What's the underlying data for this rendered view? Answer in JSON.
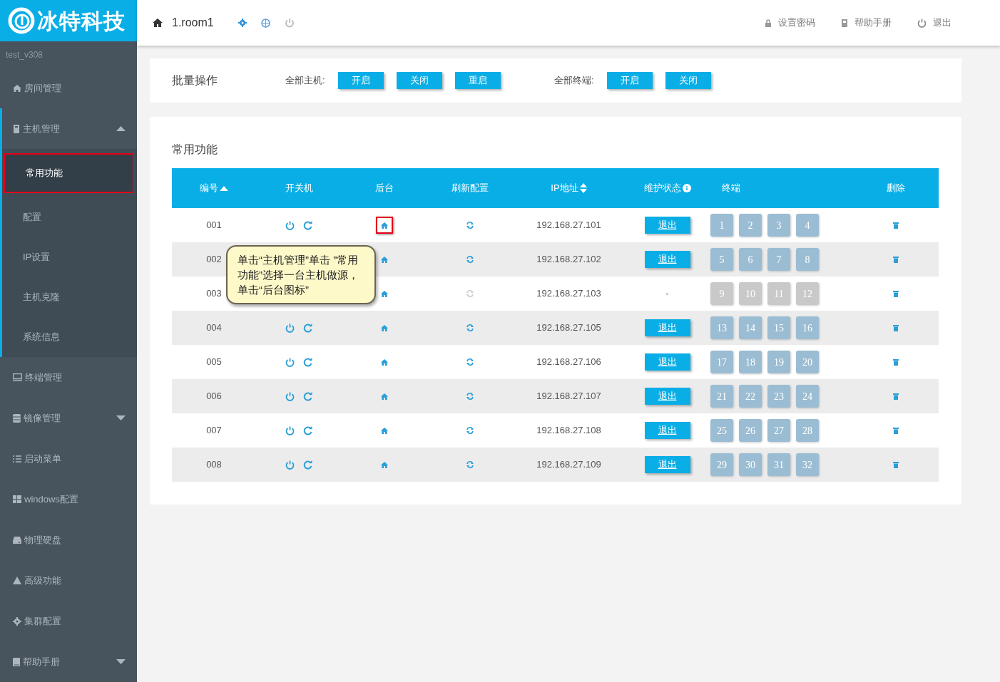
{
  "brand": {
    "name": "冰特科技"
  },
  "header": {
    "room": "1.room1",
    "links": [
      {
        "kind": "lock",
        "label": "设置密码"
      },
      {
        "kind": "book",
        "label": "帮助手册"
      },
      {
        "kind": "power",
        "label": "退出"
      }
    ]
  },
  "sidebar": {
    "version": "test_v308",
    "items": [
      {
        "kind": "home",
        "label": "房间管理"
      },
      {
        "kind": "server",
        "label": "主机管理",
        "expanded": true,
        "children": [
          {
            "label": "常用功能",
            "selected": true,
            "highlighted": true
          },
          {
            "label": "配置",
            "selected": false,
            "highlighted": false
          },
          {
            "label": "IP设置",
            "selected": false,
            "highlighted": false
          },
          {
            "label": "主机克隆",
            "selected": false,
            "highlighted": false
          },
          {
            "label": "系统信息",
            "selected": false,
            "highlighted": false
          }
        ]
      },
      {
        "kind": "monitor",
        "label": "终端管理"
      },
      {
        "kind": "disk",
        "label": "镜像管理",
        "expanded": false
      },
      {
        "kind": "list",
        "label": "启动菜单"
      },
      {
        "kind": "windows",
        "label": "windows配置"
      },
      {
        "kind": "drive",
        "label": "物理硬盘"
      },
      {
        "kind": "warning",
        "label": "高级功能"
      },
      {
        "kind": "gear",
        "label": "集群配置"
      },
      {
        "kind": "book",
        "label": "帮助手册",
        "expanded": false
      }
    ]
  },
  "batch": {
    "title": "批量操作",
    "groups": [
      {
        "label": "全部主机:",
        "buttons": [
          "开启",
          "关闭",
          "重启"
        ]
      },
      {
        "label": "全部终端:",
        "buttons": [
          "开启",
          "关闭"
        ]
      }
    ]
  },
  "table": {
    "title": "常用功能",
    "columns": [
      {
        "label": "编号",
        "sorted_ascending": true
      },
      {
        "label": "开关机"
      },
      {
        "label": "后台"
      },
      {
        "label": "刷新配置"
      },
      {
        "label": "IP地址",
        "sortable": true
      },
      {
        "label": "维护状态",
        "info": true
      },
      {
        "label": "终端"
      },
      {
        "label": "删除"
      }
    ],
    "rows": [
      {
        "id": "001",
        "online": true,
        "controls_visible": true,
        "highlighted": true,
        "ip": "192.168.27.101",
        "maintenance": "退出",
        "terminals": [
          "1",
          "2",
          "3",
          "4"
        ]
      },
      {
        "id": "002",
        "online": true,
        "controls_visible": false,
        "highlighted": false,
        "ip": "192.168.27.102",
        "maintenance": "退出",
        "terminals": [
          "5",
          "6",
          "7",
          "8"
        ]
      },
      {
        "id": "003",
        "online": false,
        "controls_visible": false,
        "highlighted": false,
        "ip": "192.168.27.103",
        "maintenance": "-",
        "terminals": [
          "9",
          "10",
          "11",
          "12"
        ]
      },
      {
        "id": "004",
        "online": true,
        "controls_visible": true,
        "highlighted": false,
        "ip": "192.168.27.105",
        "maintenance": "退出",
        "terminals": [
          "13",
          "14",
          "15",
          "16"
        ]
      },
      {
        "id": "005",
        "online": true,
        "controls_visible": true,
        "highlighted": false,
        "ip": "192.168.27.106",
        "maintenance": "退出",
        "terminals": [
          "17",
          "18",
          "19",
          "20"
        ]
      },
      {
        "id": "006",
        "online": true,
        "controls_visible": true,
        "highlighted": false,
        "ip": "192.168.27.107",
        "maintenance": "退出",
        "terminals": [
          "21",
          "22",
          "23",
          "24"
        ]
      },
      {
        "id": "007",
        "online": true,
        "controls_visible": true,
        "highlighted": false,
        "ip": "192.168.27.108",
        "maintenance": "退出",
        "terminals": [
          "25",
          "26",
          "27",
          "28"
        ]
      },
      {
        "id": "008",
        "online": true,
        "controls_visible": true,
        "highlighted": false,
        "ip": "192.168.27.109",
        "maintenance": "退出",
        "terminals": [
          "29",
          "30",
          "31",
          "32"
        ]
      }
    ]
  },
  "callout": {
    "text": "单击“主机管理”单击 ”常用功能”选择一台主机做源，单击“后台图标”"
  }
}
